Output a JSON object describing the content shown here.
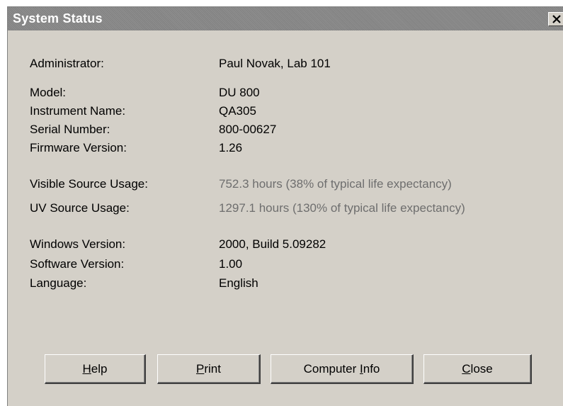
{
  "window": {
    "title": "System Status",
    "close_label": "Close window"
  },
  "fields": {
    "administrator": {
      "label": "Administrator:",
      "value": "Paul Novak, Lab 101"
    },
    "model": {
      "label": "Model:",
      "value": "DU 800"
    },
    "instrument_name": {
      "label": "Instrument Name:",
      "value": "QA305"
    },
    "serial_number": {
      "label": "Serial Number:",
      "value": "800-00627"
    },
    "firmware_version": {
      "label": "Firmware Version:",
      "value": "1.26"
    },
    "visible_source_usage": {
      "label": "Visible Source Usage:",
      "value": "752.3 hours (38% of typical life expectancy)"
    },
    "uv_source_usage": {
      "label": "UV Source Usage:",
      "value": "1297.1 hours (130% of typical life expectancy)"
    },
    "windows_version": {
      "label": "Windows Version:",
      "value": "2000, Build 5.09282"
    },
    "software_version": {
      "label": "Software Version:",
      "value": "1.00"
    },
    "language": {
      "label": "Language:",
      "value": "English"
    }
  },
  "buttons": {
    "help": {
      "pre": "",
      "accel": "H",
      "post": "elp"
    },
    "print": {
      "pre": "",
      "accel": "P",
      "post": "rint"
    },
    "computer_info": {
      "pre": "Computer ",
      "accel": "I",
      "post": "nfo"
    },
    "close": {
      "pre": "",
      "accel": "C",
      "post": "lose"
    }
  },
  "colors": {
    "dialog_background": "#d4d0c8",
    "titlebar_background": "#8a8a8a",
    "usage_text": "#6e6e6e"
  },
  "icons": {
    "close": "close-icon"
  }
}
